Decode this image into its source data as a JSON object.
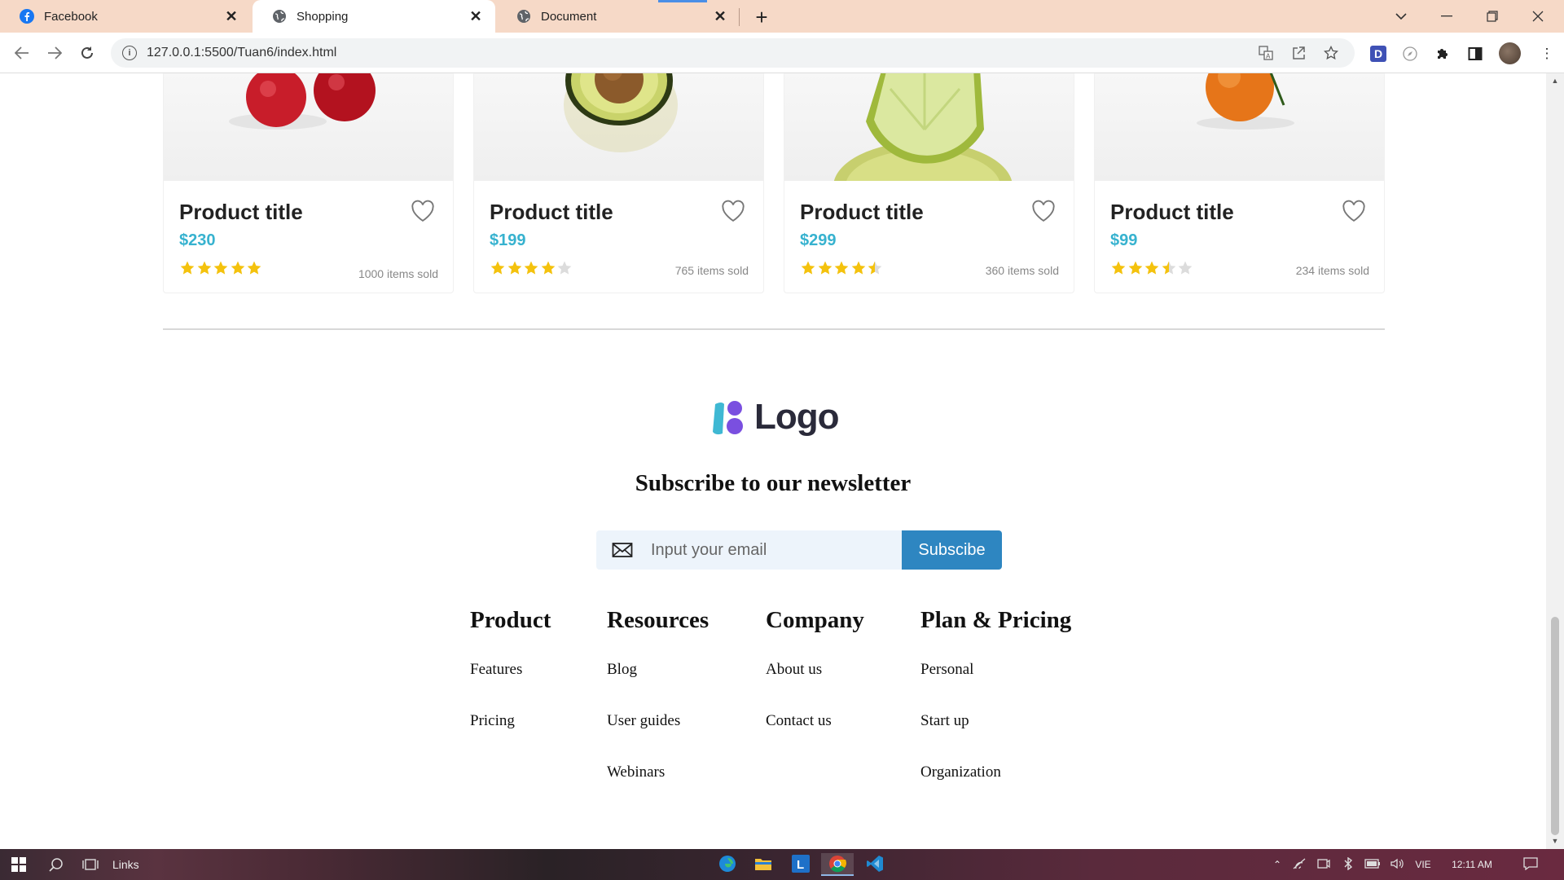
{
  "browser": {
    "tabs": [
      {
        "label": "Facebook",
        "icon": "facebook-icon",
        "active": false
      },
      {
        "label": "Shopping",
        "icon": "globe-icon",
        "active": true
      },
      {
        "label": "Document",
        "icon": "globe-icon",
        "active": false
      }
    ],
    "url": "127.0.0.1:5500/Tuan6/index.html",
    "tab_strip_color": "#f6d9c7"
  },
  "products": [
    {
      "title": "Product title",
      "price": "$230",
      "rating": 5,
      "sold": "1000 items sold",
      "fruit": "cherries"
    },
    {
      "title": "Product title",
      "price": "$199",
      "rating": 4,
      "sold": "765 items sold",
      "fruit": "avocado"
    },
    {
      "title": "Product title",
      "price": "$299",
      "rating": 4.5,
      "sold": "360 items sold",
      "fruit": "lime"
    },
    {
      "title": "Product title",
      "price": "$99",
      "rating": 3.5,
      "sold": "234 items sold",
      "fruit": "orange"
    }
  ],
  "footer": {
    "logo_text": "Logo",
    "newsletter_title": "Subscribe to our newsletter",
    "email_placeholder": "Input your email",
    "subscribe_label": "Subscibe",
    "columns": [
      {
        "heading": "Product",
        "links": [
          "Features",
          "Pricing"
        ]
      },
      {
        "heading": "Resources",
        "links": [
          "Blog",
          "User guides",
          "Webinars"
        ]
      },
      {
        "heading": "Company",
        "links": [
          "About us",
          "Contact us"
        ]
      },
      {
        "heading": "Plan & Pricing",
        "links": [
          "Personal",
          "Start up",
          "Organization"
        ]
      }
    ]
  },
  "colors": {
    "price": "#37b2cf",
    "star": "#f4c20d",
    "star_empty": "#dcdcdc",
    "button": "#2e86c1",
    "input_bg": "#edf4fb"
  },
  "taskbar": {
    "search_label": "Links",
    "language": "VIE",
    "time": "12:11 AM"
  }
}
